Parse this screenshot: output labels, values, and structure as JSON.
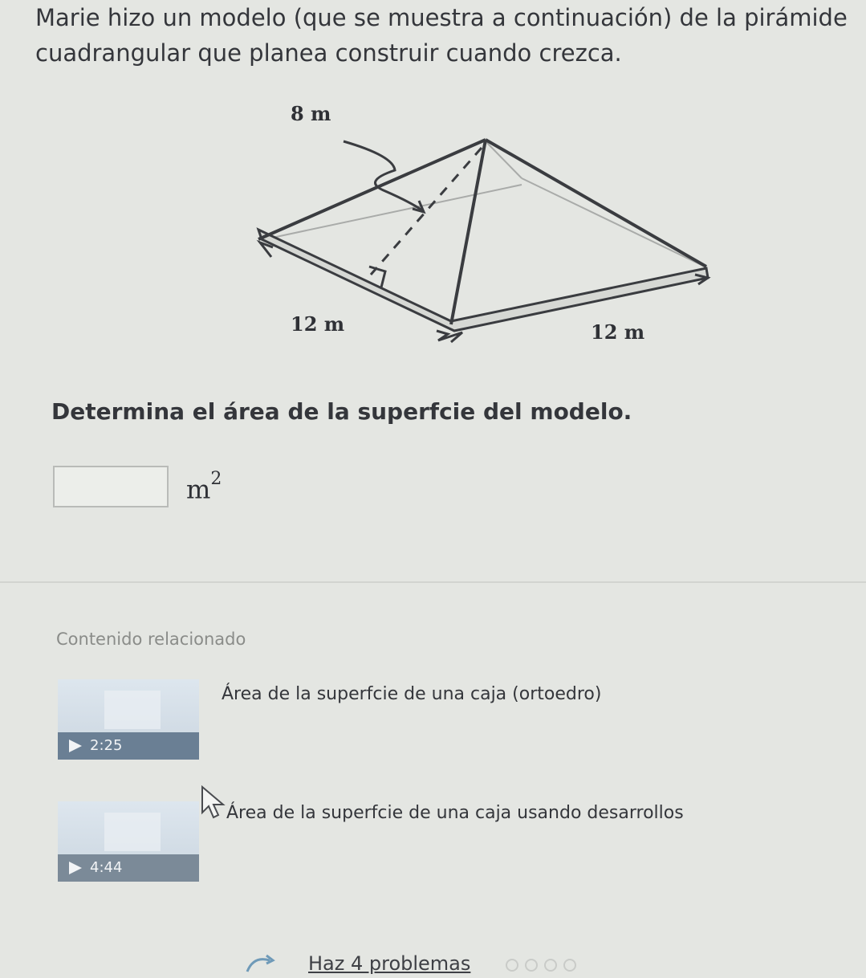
{
  "problem": {
    "text": "Marie hizo un modelo (que se muestra a continuación) de la pirámide cuadrangular que planea construir cuando crezca."
  },
  "figure": {
    "slant_label": "8 m",
    "base_left_label": "12 m",
    "base_right_label": "12 m"
  },
  "question": "Determina el área de la superfcie del modelo.",
  "answer": {
    "value": "",
    "unit_base": "m",
    "unit_exp": "2"
  },
  "related": {
    "title": "Contenido relacionado",
    "videos": [
      {
        "title": "Área de la superfcie de una caja (ortoedro)",
        "duration": "2:25"
      },
      {
        "title": "Área de la superfcie de una caja usando desarrollos",
        "duration": "4:44"
      }
    ]
  },
  "footer": {
    "label": "Haz 4 problemas"
  }
}
